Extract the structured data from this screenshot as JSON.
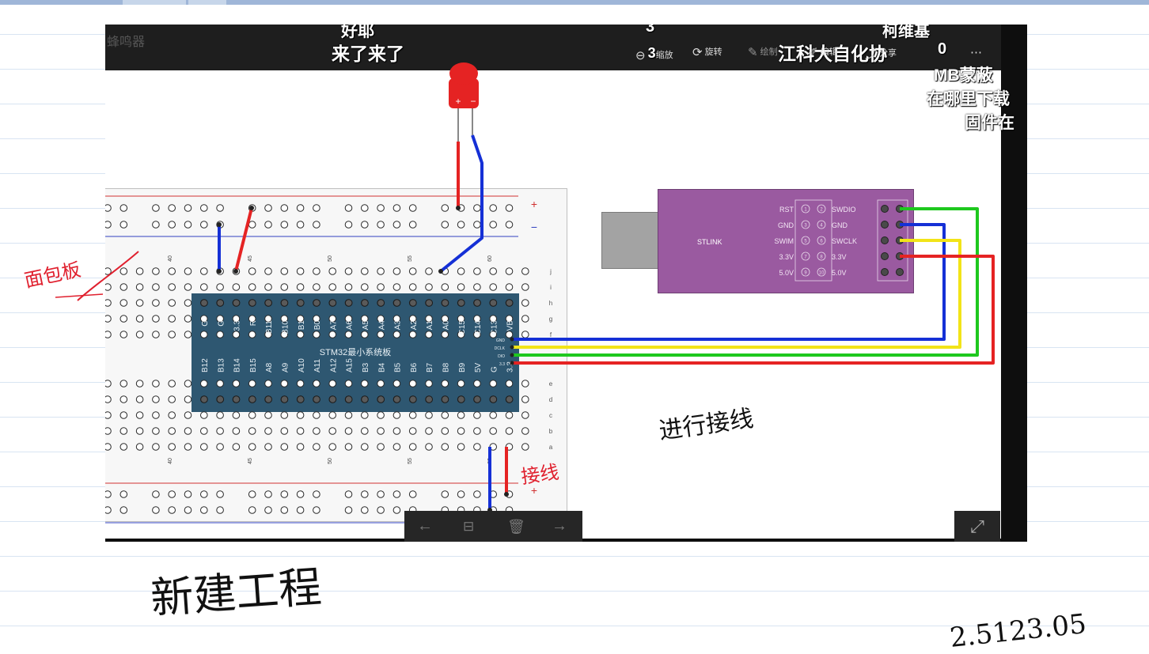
{
  "video": {
    "top_caption": "好耶",
    "caption_main": "来了来了",
    "caption_number_top": "3",
    "caption_name_right": "柯维基",
    "channel_caption": "江科大自化协",
    "ghost_label": "蜂鸣器",
    "side_captions": [
      "MB蒙蔽",
      "在哪里下载",
      "固件在"
    ],
    "tools": [
      {
        "icon": "zoom-out-icon",
        "glyph": "⊖",
        "label": "缩放"
      },
      {
        "icon": "rotate-icon",
        "glyph": "⟳",
        "label": "旋转"
      },
      {
        "icon": "pen-icon",
        "glyph": "✎",
        "label": "绘制"
      },
      {
        "icon": "edit-icon",
        "glyph": "✐",
        "label": "编辑"
      },
      {
        "icon": "share-icon",
        "glyph": "⤴",
        "label": "分享"
      },
      {
        "icon": "more-icon",
        "glyph": "⋯",
        "label": ""
      }
    ],
    "zoom_value": "3",
    "counter": "0"
  },
  "board": {
    "stm32_title": "STM32最小系统板",
    "top_pins": [
      "G",
      "G",
      "3.3",
      "R",
      "B11",
      "B10",
      "B1",
      "B0",
      "A7",
      "A6",
      "A5",
      "A4",
      "A3",
      "A2",
      "A1",
      "A0",
      "C15",
      "C14",
      "C13",
      "VB"
    ],
    "bottom_pins": [
      "B12",
      "B13",
      "B14",
      "B15",
      "A8",
      "A9",
      "A10",
      "A11",
      "A12",
      "A15",
      "B3",
      "B4",
      "B5",
      "B6",
      "B7",
      "B8",
      "B9",
      "5V",
      "G",
      "3.3"
    ],
    "side_pins": [
      "GND",
      "DCLK",
      "DIO",
      "3.3"
    ],
    "column_numbers": [
      "40",
      "45",
      "50",
      "55",
      "60"
    ],
    "row_letters_top": [
      "j",
      "i",
      "h",
      "g",
      "f"
    ],
    "row_letters_bottom": [
      "e",
      "d",
      "c",
      "b",
      "a"
    ],
    "rail_plus": "+",
    "rail_minus": "−",
    "led_plus": "+",
    "led_minus": "−"
  },
  "stlink": {
    "name": "STLINK",
    "left_labels": [
      "RST",
      "GND",
      "SWIM",
      "3.3V",
      "5.0V"
    ],
    "pin_numbers_left": [
      "1",
      "3",
      "5",
      "7",
      "9"
    ],
    "pin_numbers_right": [
      "2",
      "4",
      "6",
      "8",
      "10"
    ],
    "right_labels": [
      "SWDIO",
      "GND",
      "SWCLK",
      "3.3V",
      "5.0V"
    ]
  },
  "notes": {
    "breadboard": "面包板",
    "wiring": "进行接线",
    "connect": "接线",
    "new_project": "新建工程",
    "corner": "2.5123.05"
  },
  "colors": {
    "wire_red": "#e52323",
    "wire_blue": "#1530d6",
    "wire_green": "#1ec81e",
    "wire_yellow": "#f2e418",
    "ink_red": "#e0202e",
    "ink_black": "#111111"
  }
}
